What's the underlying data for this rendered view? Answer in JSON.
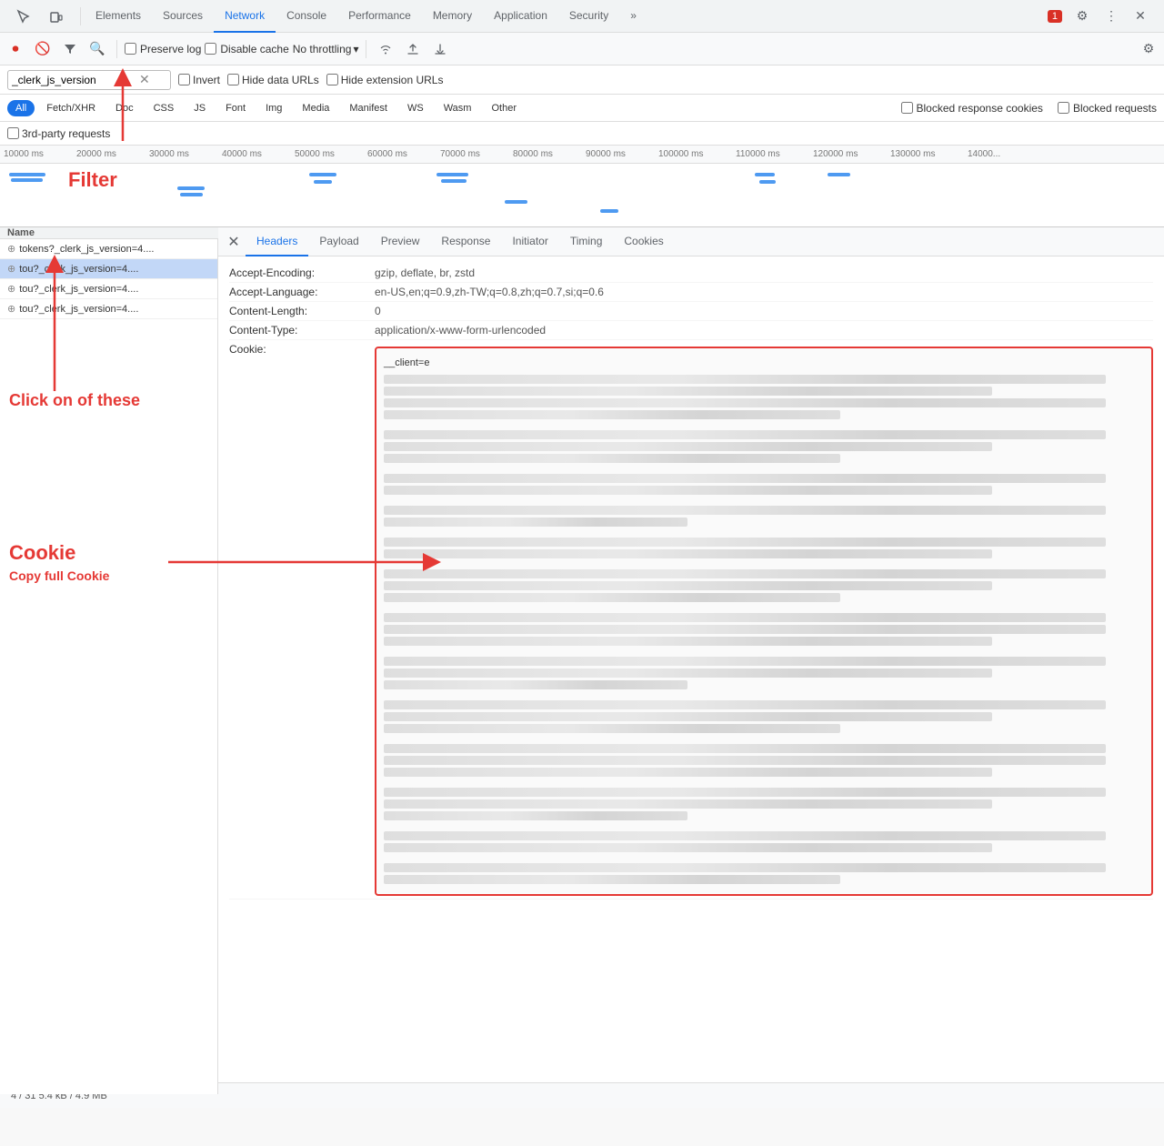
{
  "tabs": {
    "items": [
      {
        "label": "Elements",
        "active": false
      },
      {
        "label": "Sources",
        "active": false
      },
      {
        "label": "Network",
        "active": true
      },
      {
        "label": "Console",
        "active": false
      },
      {
        "label": "Performance",
        "active": false
      },
      {
        "label": "Memory",
        "active": false
      },
      {
        "label": "Application",
        "active": false
      },
      {
        "label": "Security",
        "active": false
      }
    ],
    "more_label": "»",
    "error_badge": "1"
  },
  "toolbar": {
    "preserve_log_label": "Preserve log",
    "disable_cache_label": "Disable cache",
    "no_throttling_label": "No throttling",
    "settings_tooltip": "Settings"
  },
  "filter": {
    "placeholder": "_clerk_js_version",
    "value": "_clerk_js_version",
    "invert_label": "Invert",
    "hide_data_urls_label": "Hide data URLs",
    "hide_ext_urls_label": "Hide extension URLs"
  },
  "type_filters": {
    "buttons": [
      "All",
      "Fetch/XHR",
      "Doc",
      "CSS",
      "JS",
      "Font",
      "Img",
      "Media",
      "Manifest",
      "WS",
      "Wasm",
      "Other"
    ],
    "active": "All",
    "blocked_response_cookies": "Blocked response cookies",
    "blocked_requests": "Blocked requests"
  },
  "third_party": {
    "label": "3rd-party requests"
  },
  "timeline": {
    "marks": [
      "10000 ms",
      "20000 ms",
      "30000 ms",
      "40000 ms",
      "50000 ms",
      "60000 ms",
      "70000 ms",
      "80000 ms",
      "90000 ms",
      "100000 ms",
      "110000 ms",
      "120000 ms",
      "130000 ms",
      "14000..."
    ]
  },
  "requests": {
    "column_name": "Name",
    "items": [
      {
        "name": "tokens?_clerk_js_version=4....",
        "selected": false
      },
      {
        "name": "tou?_clerk_js_version=4....",
        "selected": true
      },
      {
        "name": "tou?_clerk_js_version=4....",
        "selected": false
      },
      {
        "name": "tou?_clerk_js_version=4....",
        "selected": false
      }
    ]
  },
  "headers_panel": {
    "tabs": [
      "Headers",
      "Payload",
      "Preview",
      "Response",
      "Initiator",
      "Timing",
      "Cookies"
    ],
    "active_tab": "Headers",
    "headers": [
      {
        "name": "Accept-Encoding:",
        "value": "gzip, deflate, br, zstd"
      },
      {
        "name": "Accept-Language:",
        "value": "en-US,en;q=0.9,zh-TW;q=0.8,zh;q=0.7,si;q=0.6"
      },
      {
        "name": "Content-Length:",
        "value": "0"
      },
      {
        "name": "Content-Type:",
        "value": "application/x-www-form-urlencoded"
      },
      {
        "name": "Cookie:",
        "value": "__client=e"
      }
    ]
  },
  "annotations": {
    "filter_label": "Filter",
    "click_label": "Click on of these",
    "cookie_label": "Cookie",
    "copy_cookie_label": "Copy full Cookie"
  },
  "status_bar": {
    "text": "4 / 31   5.4 kB / 4.9 MB"
  }
}
